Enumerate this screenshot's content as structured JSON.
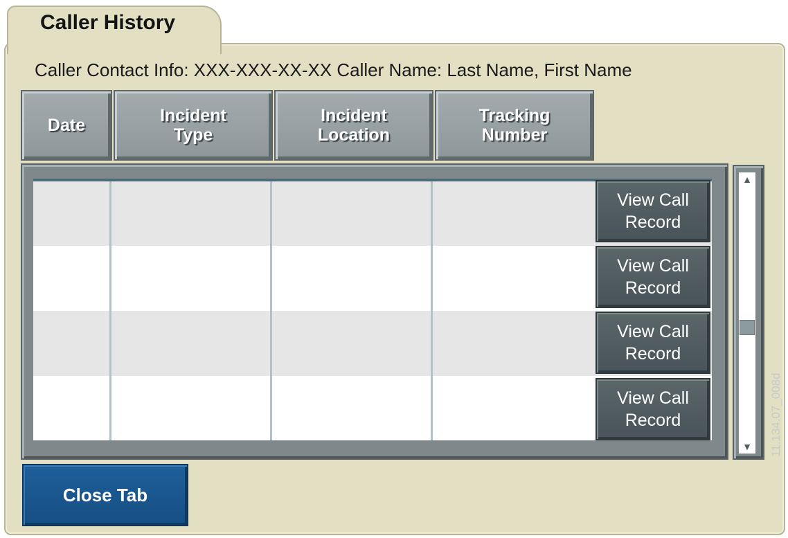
{
  "tab": {
    "title": "Caller History"
  },
  "caller_info": "Caller Contact Info: XXX-XXX-XX-XX  Caller Name: Last Name, First Name",
  "columns": [
    "Date",
    "Incident\nType",
    "Incident\nLocation",
    "Tracking\nNumber"
  ],
  "rows": [
    {
      "action": "View Call\nRecord"
    },
    {
      "action": "View Call\nRecord"
    },
    {
      "action": "View Call\nRecord"
    },
    {
      "action": "View Call\nRecord"
    }
  ],
  "close_button": "Close Tab",
  "watermark": "11.134.07_008d",
  "colors": {
    "panel": "#e2dfc3",
    "header": "#939c9f",
    "row_shaded": "#e6e6e6",
    "row_plain": "#ffffff",
    "close_button": "#1a5690"
  }
}
